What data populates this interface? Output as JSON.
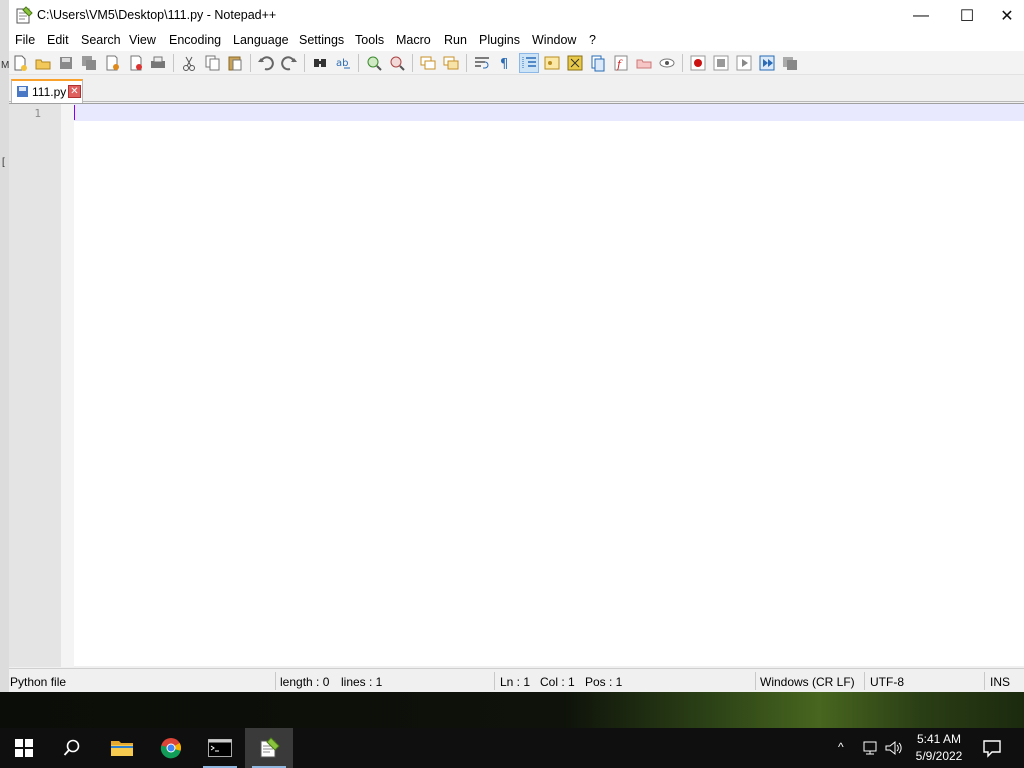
{
  "window": {
    "title": "C:\\Users\\VM5\\Desktop\\111.py - Notepad++",
    "minimize": "—",
    "maximize": "☐",
    "close": "✕"
  },
  "menu": [
    "File",
    "Edit",
    "Search",
    "View",
    "Encoding",
    "Language",
    "Settings",
    "Tools",
    "Macro",
    "Run",
    "Plugins",
    "Window",
    "?"
  ],
  "tab": {
    "label": "111.py",
    "close": "✕"
  },
  "editor": {
    "line_number": "1"
  },
  "status": {
    "file_type": "Python file",
    "length": "length : 0",
    "lines": "lines : 1",
    "ln": "Ln : 1",
    "col": "Col : 1",
    "pos": "Pos : 1",
    "eol": "Windows (CR LF)",
    "encoding": "UTF-8",
    "mode": "INS"
  },
  "desktop": {
    "edge_letter": "M",
    "edge_mark": "["
  },
  "taskbar": {
    "time": "5:41 AM",
    "date": "5/9/2022",
    "chevron": "^"
  },
  "colors": {
    "tab_accent": "#f9a12a",
    "current_line": "#e8e8ff",
    "caret": "#8000ff",
    "taskbar": "#0f0f0f"
  }
}
